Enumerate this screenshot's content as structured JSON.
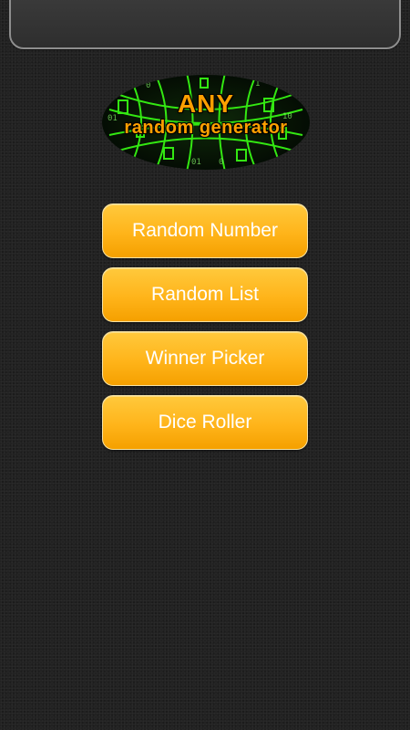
{
  "logo": {
    "line1": "ANY",
    "line2": "random generator"
  },
  "menu": {
    "items": [
      {
        "label": "Random Number"
      },
      {
        "label": "Random List"
      },
      {
        "label": "Winner Picker"
      },
      {
        "label": "Dice Roller"
      }
    ]
  },
  "colors": {
    "accent": "#ffb41a",
    "logo_text": "#ffa000",
    "matrix_green": "#39ff14",
    "background": "#222222"
  }
}
